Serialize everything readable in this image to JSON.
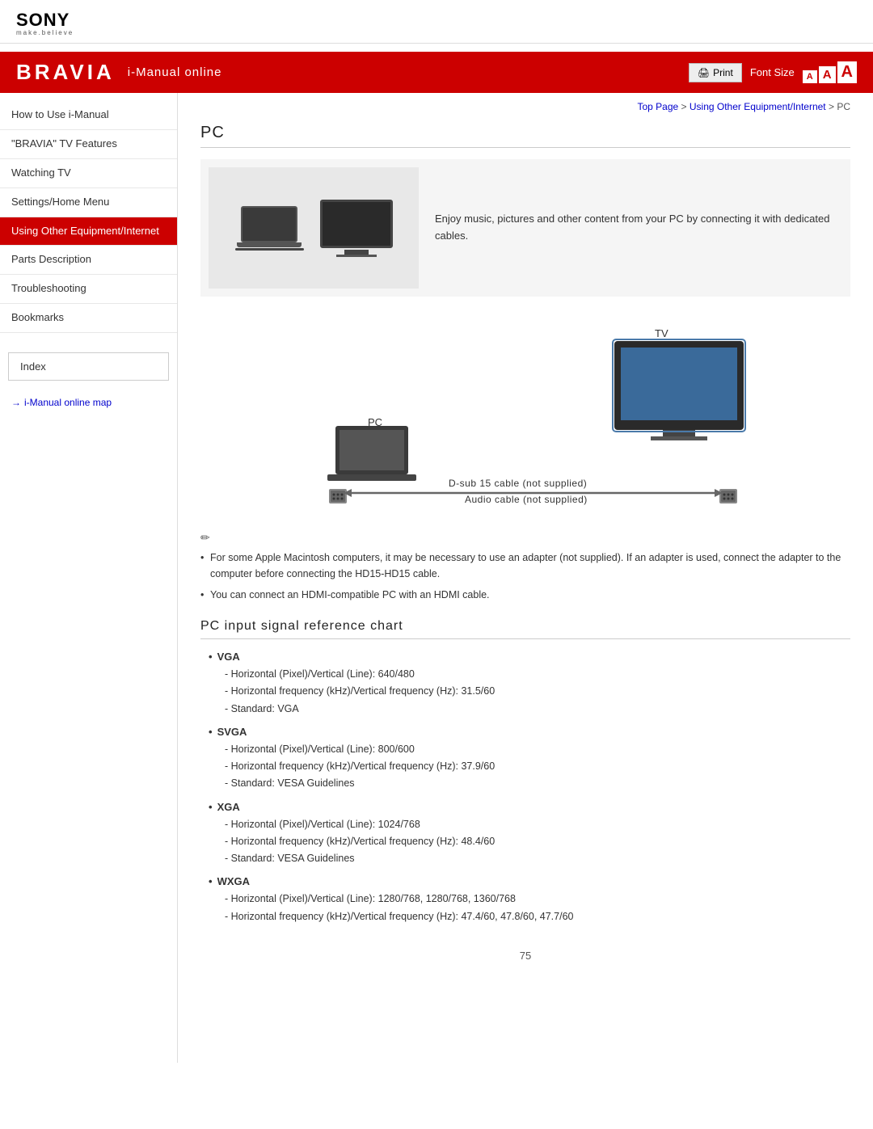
{
  "brand": {
    "logo": "SONY",
    "tagline": "make.believe",
    "product": "BRAVIA",
    "subtitle": "i-Manual online"
  },
  "toolbar": {
    "print_label": "Print",
    "font_size_label": "Font Size",
    "font_small": "A",
    "font_medium": "A",
    "font_large": "A"
  },
  "breadcrumb": {
    "top": "Top Page",
    "middle": "Using Other Equipment/Internet",
    "current": "PC"
  },
  "sidebar": {
    "items": [
      {
        "label": "How to Use i-Manual",
        "active": false
      },
      {
        "label": "\"BRAVIA\" TV Features",
        "active": false
      },
      {
        "label": "Watching TV",
        "active": false
      },
      {
        "label": "Settings/Home Menu",
        "active": false
      },
      {
        "label": "Using Other Equipment/Internet",
        "active": true
      },
      {
        "label": "Parts Description",
        "active": false
      },
      {
        "label": "Troubleshooting",
        "active": false
      },
      {
        "label": "Bookmarks",
        "active": false
      }
    ],
    "index_label": "Index",
    "link_label": "i-Manual online map"
  },
  "page": {
    "title": "PC",
    "intro_text": "Enjoy music, pictures and other content from your PC by connecting it with dedicated cables.",
    "diagram_labels": {
      "tv": "TV",
      "pc": "PC",
      "dsub_cable": "D-sub 15 cable (not supplied)",
      "audio_cable": "Audio cable (not supplied)"
    },
    "notes": [
      "For some Apple Macintosh computers, it may be necessary to use an adapter (not supplied). If an adapter is used, connect the adapter to the computer before connecting the HD15-HD15 cable.",
      "You can connect an HDMI-compatible PC with an HDMI cable."
    ],
    "chart_title": "PC input signal reference chart",
    "signals": [
      {
        "name": "VGA",
        "details": [
          "Horizontal (Pixel)/Vertical (Line): 640/480",
          "Horizontal frequency (kHz)/Vertical frequency (Hz): 31.5/60",
          "Standard: VGA"
        ]
      },
      {
        "name": "SVGA",
        "details": [
          "Horizontal (Pixel)/Vertical (Line): 800/600",
          "Horizontal frequency (kHz)/Vertical frequency (Hz): 37.9/60",
          "Standard: VESA Guidelines"
        ]
      },
      {
        "name": "XGA",
        "details": [
          "Horizontal (Pixel)/Vertical (Line): 1024/768",
          "Horizontal frequency (kHz)/Vertical frequency (Hz): 48.4/60",
          "Standard: VESA Guidelines"
        ]
      },
      {
        "name": "WXGA",
        "details": [
          "Horizontal (Pixel)/Vertical (Line): 1280/768, 1280/768, 1360/768",
          "Horizontal frequency (kHz)/Vertical frequency (Hz): 47.4/60, 47.8/60, 47.7/60"
        ]
      }
    ],
    "page_number": "75"
  }
}
